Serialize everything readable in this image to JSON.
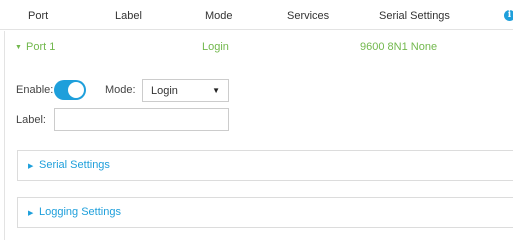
{
  "header": {
    "columns": [
      "Port",
      "Label",
      "Mode",
      "Services",
      "Serial Settings"
    ],
    "info_icon": "info-circle-icon"
  },
  "port_row": {
    "port": "Port 1",
    "label": "",
    "mode": "Login",
    "serial_settings": "9600 8N1 None",
    "expanded": true
  },
  "form": {
    "enable_label": "Enable:",
    "enable_on": true,
    "mode_label": "Mode:",
    "mode_value": "Login",
    "label_label": "Label:",
    "label_value": ""
  },
  "sections": [
    {
      "title": "Serial Settings",
      "icon": "triangle-right-icon"
    },
    {
      "title": "Logging Settings",
      "icon": "triangle-right-icon"
    }
  ],
  "colors": {
    "accent_blue": "#1e9fdb",
    "accent_green": "#72b84d"
  }
}
